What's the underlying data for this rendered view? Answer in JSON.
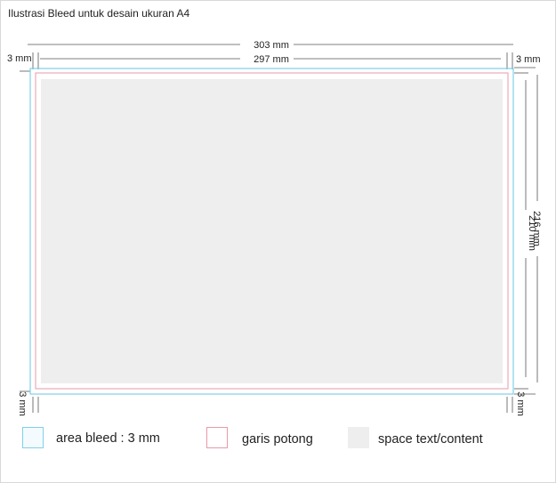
{
  "title": "Ilustrasi Bleed untuk desain ukuran A4",
  "dimensions": {
    "outer_width": "303 mm",
    "inner_width": "297 mm",
    "outer_height": "216 mm",
    "inner_height": "210 mm",
    "bleed_left": "3 mm",
    "bleed_right": "3 mm",
    "bleed_bottom_left": "3 mm",
    "bleed_bottom_right": "3 mm"
  },
  "legend": [
    {
      "label": "area bleed : 3 mm",
      "color": "#7fd0ea"
    },
    {
      "label": "garis potong",
      "color": "#e89aa8"
    },
    {
      "label": "space text/content",
      "color": "#eeeeee"
    }
  ],
  "colors": {
    "bleed_line": "#7fd0ea",
    "trim_line": "#e89aa8",
    "content_fill": "#eeeeee",
    "dimension_line": "#555555"
  }
}
